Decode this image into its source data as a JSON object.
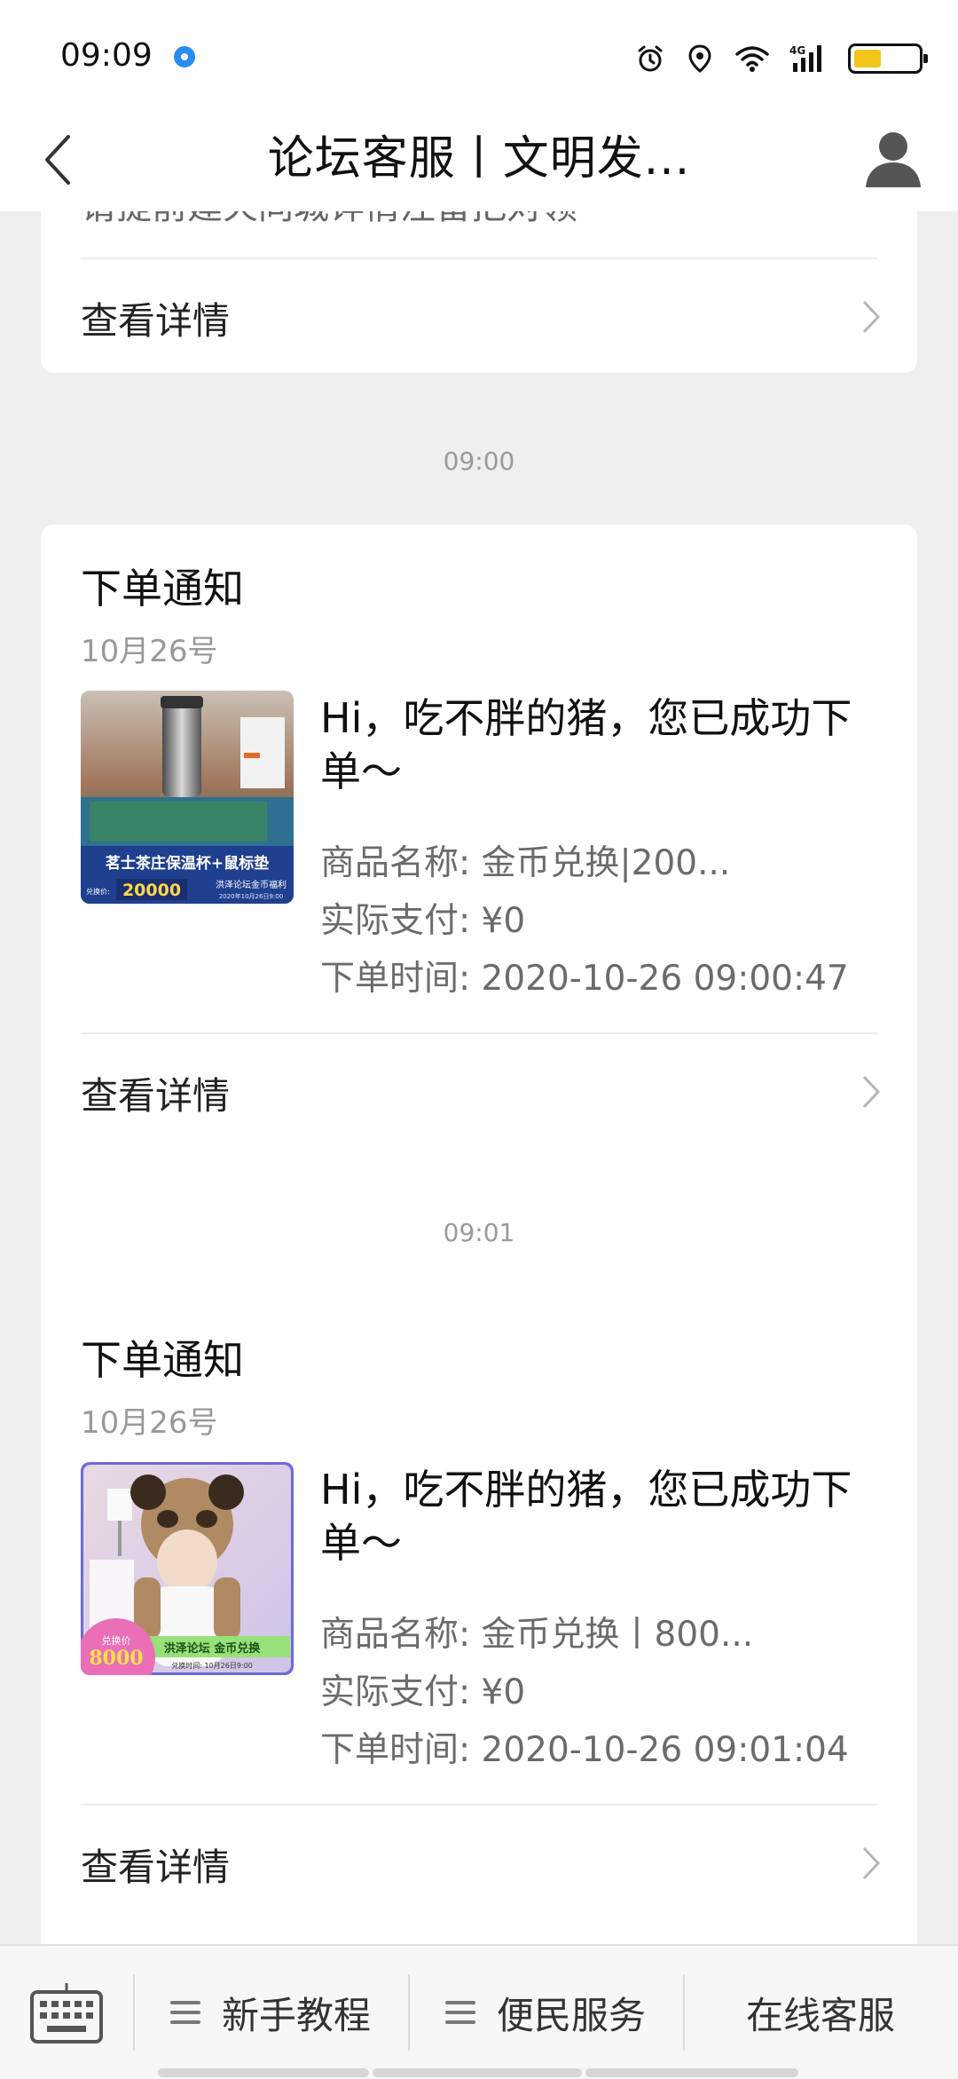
{
  "status_bar": {
    "time": "09:09"
  },
  "header": {
    "title": "论坛客服丨文明发..."
  },
  "prev_card": {
    "partial_text": "请提前建火同城详情注留把对领",
    "detail_label": "查看详情"
  },
  "messages": [
    {
      "timestamp": "09:00",
      "title": "下单通知",
      "date": "10月26号",
      "headline": "Hi，吃不胖的猪，您已成功下单～",
      "product": "商品名称: 金币兑换|200...",
      "paid": "实际支付: ¥0",
      "order_time": "下单时间: 2020-10-26 09:00:47",
      "detail_label": "查看详情",
      "thumb": {
        "caption": "茗士茶庄保温杯+鼠标垫",
        "price": "20000",
        "tag": "洪泽论坛金币福利",
        "price_prefix": "兑换价:",
        "sub": "2020年10月26日9:00"
      }
    },
    {
      "timestamp": "09:01",
      "title": "下单通知",
      "date": "10月26号",
      "headline": "Hi，吃不胖的猪，您已成功下单～",
      "product": "商品名称: 金币兑换丨800...",
      "paid": "实际支付: ¥0",
      "order_time": "下单时间: 2020-10-26 09:01:04",
      "detail_label": "查看详情",
      "thumb": {
        "badge_top": "兑换价",
        "price": "8000",
        "tag": "洪泽论坛 金币兑换",
        "sub": "兑换时间: 10月26日9:00"
      }
    }
  ],
  "bottom_menu": {
    "items": [
      "新手教程",
      "便民服务",
      "在线客服"
    ]
  },
  "colors": {
    "accent_blue": "#2a8cf0",
    "battery": "#f2c51a"
  }
}
